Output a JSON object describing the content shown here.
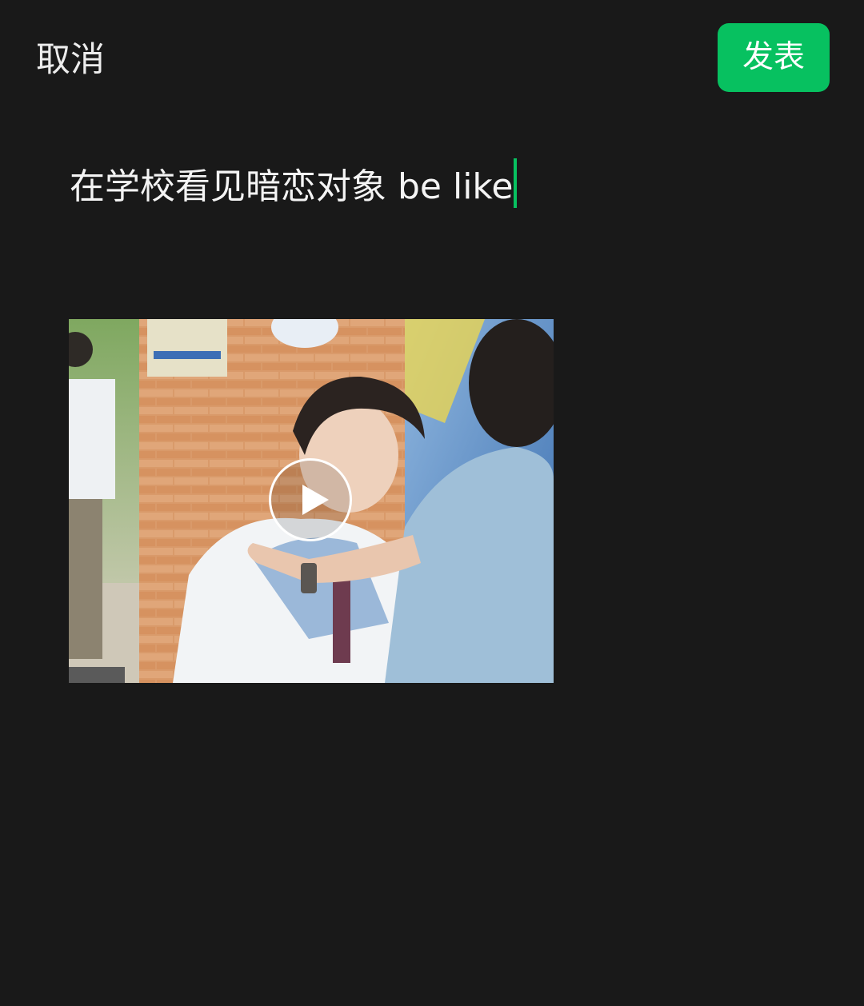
{
  "header": {
    "cancel_label": "取消",
    "publish_label": "发表"
  },
  "composer": {
    "text": "在学校看见暗恋对象 be like"
  },
  "attachment": {
    "type": "video",
    "play_icon": "play-icon"
  },
  "colors": {
    "background": "#191919",
    "accent": "#07c160"
  }
}
